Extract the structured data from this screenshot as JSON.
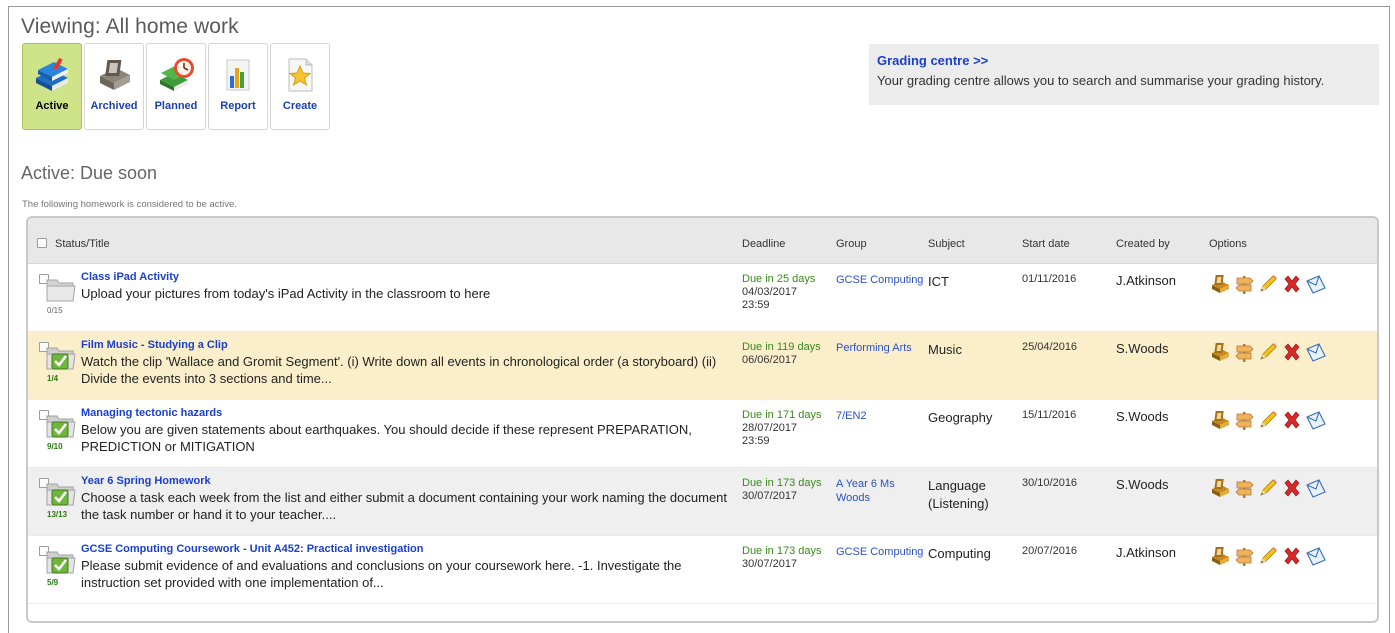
{
  "page": {
    "title": "Viewing: All home work"
  },
  "toolbar": {
    "buttons": [
      {
        "label": "Active",
        "icon": "books-stack-icon",
        "active": true
      },
      {
        "label": "Archived",
        "icon": "archive-box-icon",
        "active": false
      },
      {
        "label": "Planned",
        "icon": "planned-clock-icon",
        "active": false
      },
      {
        "label": "Report",
        "icon": "bar-chart-icon",
        "active": false
      },
      {
        "label": "Create",
        "icon": "star-document-icon",
        "active": false
      }
    ]
  },
  "grading": {
    "link": "Grading centre >>",
    "description": "Your grading centre allows you to search and summarise your grading history."
  },
  "section": {
    "title": "Active: Due soon",
    "subtitle": "The following homework is considered to be active."
  },
  "table": {
    "headers": {
      "status_title": "Status/Title",
      "deadline": "Deadline",
      "group": "Group",
      "subject": "Subject",
      "start_date": "Start date",
      "created_by": "Created by",
      "options": "Options"
    },
    "rows": [
      {
        "title": "Class iPad Activity",
        "description": "Upload your pictures from today's iPad Activity in the classroom to here",
        "count": "0/15",
        "status": "gray-folder-icon",
        "due": "Due in 25 days",
        "deadline": "04/03/2017 23:59",
        "group": "GCSE Computing",
        "subject": "ICT",
        "start_date": "01/11/2016",
        "created_by": "J.Atkinson"
      },
      {
        "title": "Film Music - Studying a Clip",
        "description": "Watch the clip 'Wallace and Gromit Segment'. (i) Write down all events in chronological order (a storyboard) (ii) Divide the events into 3 sections and time...",
        "count": "1/4",
        "status": "green-check-folder-icon",
        "due": "Due in 119 days",
        "deadline": "06/06/2017",
        "group": "Performing Arts",
        "subject": "Music",
        "start_date": "25/04/2016",
        "created_by": "S.Woods"
      },
      {
        "title": "Managing tectonic hazards",
        "description": "Below you are given statements about earthquakes. You should decide if these represent PREPARATION, PREDICTION or MITIGATION",
        "count": "9/10",
        "status": "green-check-folder-icon",
        "due": "Due in 171 days",
        "deadline": "28/07/2017 23:59",
        "group": "7/EN2",
        "subject": "Geography",
        "start_date": "15/11/2016",
        "created_by": "S.Woods"
      },
      {
        "title": "Year 6 Spring Homework",
        "description": "Choose a task each week from the list and either submit a document containing your work naming the document the task number or hand it to your teacher....",
        "count": "13/13",
        "status": "green-check-folder-icon",
        "due": "Due in 173 days",
        "deadline": "30/07/2017",
        "group": "A Year 6 Ms Woods",
        "subject": "Language (Listening)",
        "start_date": "30/10/2016",
        "created_by": "S.Woods"
      },
      {
        "title": "GCSE Computing Coursework - Unit A452: Practical investigation",
        "description": "Please submit evidence of and evaluations and conclusions on your coursework here. -1. Investigate the instruction set provided with one implementation of...",
        "count": "5/9",
        "status": "green-check-folder-icon",
        "due": "Due in 173 days",
        "deadline": "30/07/2017",
        "group": "GCSE Computing",
        "subject": "Computing",
        "start_date": "20/07/2016",
        "created_by": "J.Atkinson"
      }
    ],
    "option_icons": [
      "archive-icon",
      "signpost-icon",
      "pencil-icon",
      "delete-x-icon",
      "envelope-icon"
    ]
  }
}
